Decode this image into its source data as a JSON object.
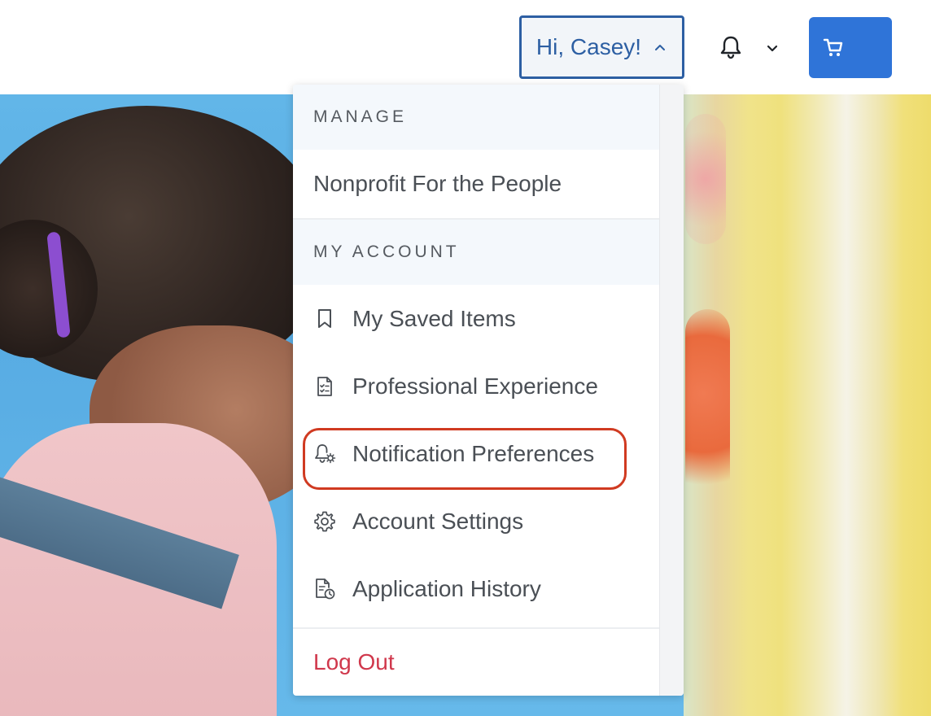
{
  "header": {
    "greeting": "Hi, Casey!",
    "icons": {
      "greeting_chevron": "chevron-up-icon",
      "bell": "bell-icon",
      "bell_chevron": "chevron-down-icon",
      "cart": "cart-icon"
    }
  },
  "menu": {
    "manage_header": "MANAGE",
    "org_name": "Nonprofit For the People",
    "account_header": "MY ACCOUNT",
    "items": [
      {
        "label": "My Saved Items",
        "icon": "bookmark-icon"
      },
      {
        "label": "Professional Experience",
        "icon": "checklist-document-icon"
      },
      {
        "label": "Notification Preferences",
        "icon": "bell-gear-icon",
        "highlighted": true
      },
      {
        "label": "Account Settings",
        "icon": "gear-icon"
      },
      {
        "label": "Application History",
        "icon": "document-clock-icon"
      }
    ],
    "logout": "Log Out"
  },
  "colors": {
    "accent_blue": "#2d5fa3",
    "cart_blue": "#2f74d8",
    "logout_red": "#d0384c",
    "highlight_red": "#d03a21"
  }
}
